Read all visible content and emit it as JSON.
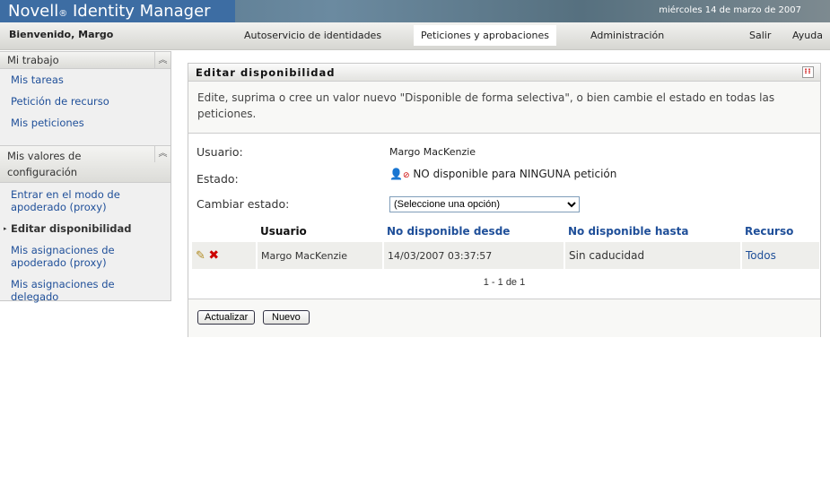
{
  "header": {
    "brand": "Novell",
    "brand_mark": "®",
    "product": "Identity Manager",
    "date": "miércoles 14 de marzo de 2007"
  },
  "nav": {
    "welcome": "Bienvenido, Margo",
    "tabs": [
      {
        "label": "Autoservicio de identidades"
      },
      {
        "label": "Peticiones y aprobaciones",
        "active": true
      },
      {
        "label": "Administración"
      }
    ],
    "logout": "Salir",
    "help": "Ayuda"
  },
  "sidebar": {
    "sections": [
      {
        "title": "Mi trabajo",
        "items": [
          "Mis tareas",
          "Petición de recurso",
          "Mis peticiones"
        ]
      },
      {
        "title": "Mis valores de configuración",
        "items": [
          "Entrar en el modo de apoderado (proxy)",
          "Editar disponibilidad",
          "Mis asignaciones de apoderado (proxy)",
          "Mis asignaciones de delegado"
        ],
        "active": "Editar disponibilidad"
      }
    ]
  },
  "panel": {
    "title": "Editar disponibilidad",
    "description": "Edite, suprima o cree un valor nuevo \"Disponible de forma selectiva\", o bien cambie el estado en todas las peticiones.",
    "user_label": "Usuario:",
    "user_value": "Margo MacKenzie",
    "status_label": "Estado:",
    "status_value": "NO disponible para NINGUNA petición",
    "change_label": "Cambiar estado:",
    "change_select": "(Seleccione una opción)",
    "table": {
      "headers": [
        "Usuario",
        "No disponible desde",
        "No disponible hasta",
        "Recurso"
      ],
      "rows": [
        {
          "user": "Margo MacKenzie",
          "from": "14/03/2007 03:37:57",
          "to": "Sin caducidad",
          "resource": "Todos"
        }
      ]
    },
    "pagination": "1 - 1 de 1",
    "buttons": {
      "update": "Actualizar",
      "new": "Nuevo"
    }
  }
}
